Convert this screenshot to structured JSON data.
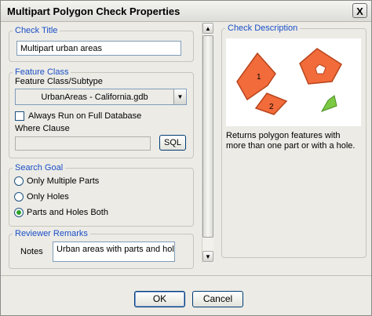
{
  "window": {
    "title": "Multipart Polygon Check Properties",
    "close_label": "X"
  },
  "check_title": {
    "legend": "Check Title",
    "value": "Multipart urban areas"
  },
  "feature_class": {
    "legend": "Feature Class",
    "subtype_label": "Feature Class/Subtype",
    "combo_value": "UrbanAreas -  California.gdb",
    "always_run_label": "Always Run on Full Database",
    "always_run_checked": false,
    "where_clause_label": "Where Clause",
    "where_clause_value": "",
    "sql_label": "SQL"
  },
  "search_goal": {
    "legend": "Search Goal",
    "options": [
      {
        "label": "Only Multiple Parts",
        "selected": false
      },
      {
        "label": "Only Holes",
        "selected": false
      },
      {
        "label": "Parts and Holes Both",
        "selected": true
      }
    ]
  },
  "reviewer_remarks": {
    "legend": "Reviewer Remarks",
    "notes_label": "Notes",
    "notes_value": "Urban areas with parts and holes"
  },
  "check_description": {
    "legend": "Check Description",
    "diagram_labels": [
      "1",
      "2"
    ],
    "text": "Returns polygon features with more than one part or with a hole."
  },
  "buttons": {
    "ok": "OK",
    "cancel": "Cancel"
  },
  "colors": {
    "accent": "#1a4fc6",
    "polygon_fill": "#f26b3a",
    "polygon_stroke": "#b8451d",
    "green_fill": "#7ac943"
  }
}
